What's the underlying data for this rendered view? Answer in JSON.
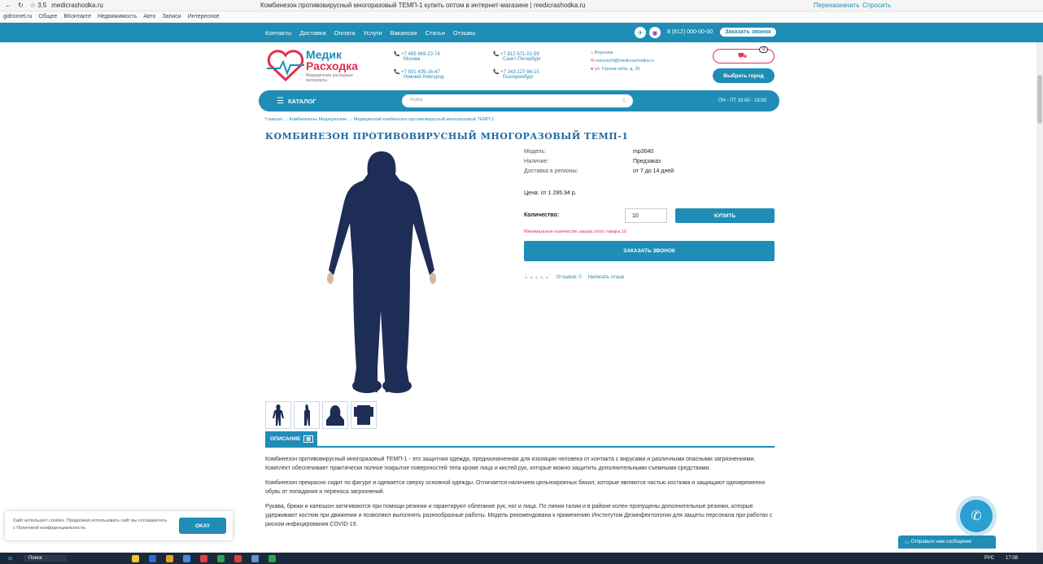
{
  "browser": {
    "url": "medicrashodka.ru",
    "tab_title": "Комбинезон противовирусный многоразовый ТЕМП-1 купить оптом в интернет-магазине | medicrashodka.ru",
    "counter": "☆ 3.5",
    "right": [
      "Переназначить",
      "Спросить"
    ]
  },
  "bookmarks": [
    "gidromet.ru",
    "Общее",
    "ВКонтакте",
    "Недвижимость",
    "Авто",
    "Записи",
    "Интересное"
  ],
  "topnav": {
    "links": [
      "Контакты",
      "Доставка",
      "Оплата",
      "Услуги",
      "Вакансии",
      "Статьи",
      "Отзывы"
    ],
    "phone": "8 (812) 000-00-00",
    "callback": "Заказать звонок"
  },
  "header": {
    "logo_line1": "Медик",
    "logo_line2": "Расходка",
    "logo_sub": "Медицинские расходные материалы",
    "phones": [
      {
        "num": "+7 495 669-22-74",
        "city": "Москва"
      },
      {
        "num": "+7 812 671-01-59",
        "city": "Санкт-Петербург"
      },
      {
        "num": "+7 831 435-16-47",
        "city": "Нижний Новгород"
      },
      {
        "num": "+7 343 227-96-15",
        "city": "Екатеринбург"
      }
    ],
    "contact": {
      "city": "Воронеж",
      "email": "voronezh@medicrashodka.ru",
      "address": "ул. Героев неба, д. 26"
    },
    "cart_count": "0",
    "choose_city": "Выбрать город"
  },
  "catbar": {
    "catalog": "КАТАЛОГ",
    "search_placeholder": "поиск",
    "hours": "ПН - ПТ 10:00 - 19:00"
  },
  "breadcrumb": "Главная → Комбинезоны Медицинские → Медицинский комбинезон противовирусный многоразовый ТЕМП-1",
  "product": {
    "title": "КОМБИНЕЗОН ПРОТИВОВИРУСНЫЙ МНОГОРАЗОВЫЙ ТЕМП-1",
    "specs": [
      {
        "k": "Модель:",
        "v": "mp3040"
      },
      {
        "k": "Наличие:",
        "v": "Предзаказ"
      },
      {
        "k": "Доставка в регионы:",
        "v": "от 7 до 14 дней"
      }
    ],
    "price": "Цена: от 1 295.94 р.",
    "qty_label": "Количество:",
    "qty": "10",
    "buy": "КУПИТЬ",
    "min_note": "Минимальное количество заказа этого товара 10",
    "call": "ЗАКАЗАТЬ ЗВОНОК",
    "reviews": "Отзывов: 0",
    "write_review": "Написать отзыв",
    "rating": 0
  },
  "tab_label": "ОПИСАНИЕ",
  "description": [
    "Комбинезон противовирусный многоразовый ТЕМП-1 - это защитная одежда, предназначенная для изоляции человека от контакта с вирусами и различными опасными загрязнениями. Комплект обеспечивает практически полное покрытие поверхностей тела кроме лица и кистей рук, которые можно защитить дополнительными съемными средствами.",
    "Комбинезон прекрасно сидит по фигуре и одевается сверху основной одежды. Отличается наличием цельнокроеных бахил, которые являются частью костюма и защищают одновременно обувь от попадания и переноса загрязнений.",
    "Рукава, брюки и капюшон затягиваются при помощи резинки и гарантируют облегание рук, ног и лица. По линии талии и в районе колен пропущены дополнительные резинки, которые удерживают костюм при движении и позволяют выполнять разнообразные работы. Модель рекомендована к применению Институтом Дезинфектологии для защиты персонала при работах с риском инфицирования COVID-19."
  ],
  "cookie": {
    "text": "Сайт использует cookies. Продолжая использовать сайт вы соглашаетесь с Политикой конфиденциальности.",
    "ok": "OKAY"
  },
  "chat": "Отправьте нам сообщение",
  "taskbar": {
    "search": "Поиск",
    "time": "17:08",
    "lang": "РУС"
  },
  "colors": {
    "brand": "#1f8db6",
    "logo": "#e0314d",
    "suit": "#1e2d55"
  }
}
